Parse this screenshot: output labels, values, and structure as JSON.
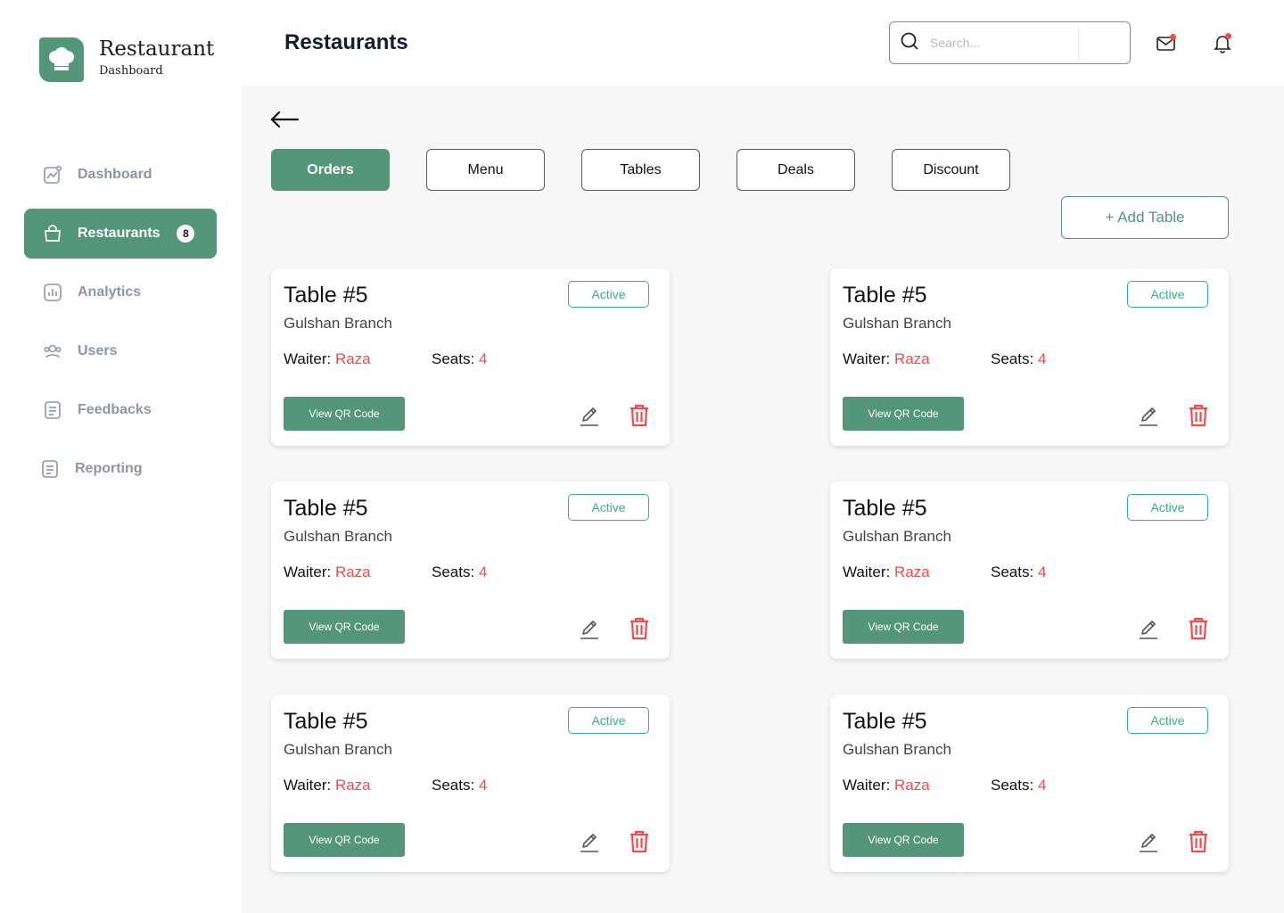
{
  "brand": {
    "title": "Restaurant",
    "subtitle": "Dashboard"
  },
  "sidebar": {
    "items": [
      {
        "label": "Dashboard",
        "icon": "dashboard-chart-icon"
      },
      {
        "label": "Restaurants",
        "icon": "shopping-bag-icon",
        "badge": "8",
        "active": true
      },
      {
        "label": "Analytics",
        "icon": "analytics-icon"
      },
      {
        "label": "Users",
        "icon": "users-icon"
      },
      {
        "label": "Feedbacks",
        "icon": "document-icon"
      },
      {
        "label": "Reporting",
        "icon": "document-icon"
      }
    ]
  },
  "header": {
    "title": "Restaurants",
    "search_placeholder": "Search...",
    "icons": [
      "search-icon",
      "mail-icon",
      "bell-icon"
    ]
  },
  "tabs": [
    "Orders",
    "Menu",
    "Tables",
    "Deals",
    "Discount"
  ],
  "active_tab": "Orders",
  "add_button": "+ Add Table",
  "labels": {
    "waiter": "Waiter:",
    "seats": "Seats:",
    "qr": "View QR Code"
  },
  "cards": [
    {
      "title": "Table #5",
      "branch": "Gulshan Branch",
      "status": "Active",
      "waiter": "Raza",
      "seats": "4"
    },
    {
      "title": "Table #5",
      "branch": "Gulshan Branch",
      "status": "Active",
      "waiter": "Raza",
      "seats": "4"
    },
    {
      "title": "Table #5",
      "branch": "Gulshan Branch",
      "status": "Active",
      "waiter": "Raza",
      "seats": "4"
    },
    {
      "title": "Table #5",
      "branch": "Gulshan Branch",
      "status": "Active",
      "waiter": "Raza",
      "seats": "4"
    },
    {
      "title": "Table #5",
      "branch": "Gulshan Branch",
      "status": "Active",
      "waiter": "Raza",
      "seats": "4"
    },
    {
      "title": "Table #5",
      "branch": "Gulshan Branch",
      "status": "Active",
      "waiter": "Raza",
      "seats": "4"
    }
  ],
  "colors": {
    "accent": "#53967a",
    "status": "#35b27f",
    "danger": "#f24b4b",
    "muted_nav": "#8f95a7"
  }
}
